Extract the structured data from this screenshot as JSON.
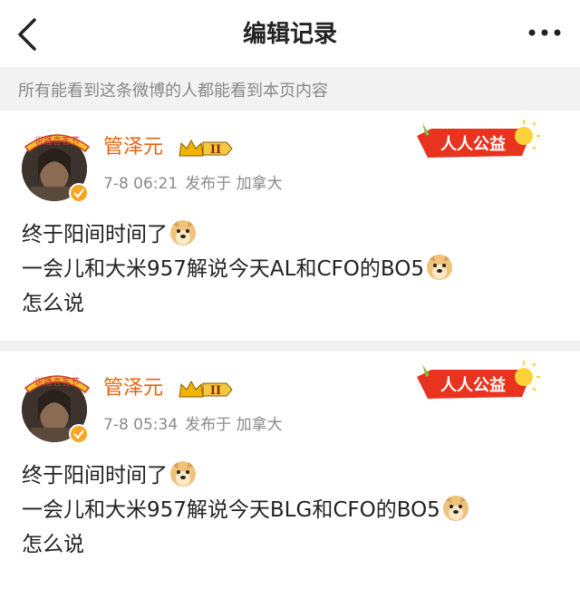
{
  "header": {
    "title": "编辑记录",
    "back_icon": "chevron-left-icon",
    "more_icon": "more-dots-icon"
  },
  "notice": "所有能看到这条微博的人都能看到本页内容",
  "colors": {
    "username": "#e8620c",
    "meta": "#8a8a8a",
    "background": "#f2f2f2"
  },
  "posts": [
    {
      "username": "管泽元",
      "avatar_badge": "说播喜客节",
      "vip_level": "II",
      "time": "7-8 06:21",
      "published_from": "发布于 加拿大",
      "charity_label": "人人公益",
      "lines": [
        "终于阳间时间了",
        "一会儿和大米957解说今天AL和CFO的BO5",
        "怎么说"
      ],
      "emoji": "doge-icon"
    },
    {
      "username": "管泽元",
      "avatar_badge": "说播喜客节",
      "vip_level": "II",
      "time": "7-8 05:34",
      "published_from": "发布于 加拿大",
      "charity_label": "人人公益",
      "lines": [
        "终于阳间时间了",
        "一会儿和大米957解说今天BLG和CFO的BO5",
        "怎么说"
      ],
      "emoji": "doge-icon"
    }
  ]
}
